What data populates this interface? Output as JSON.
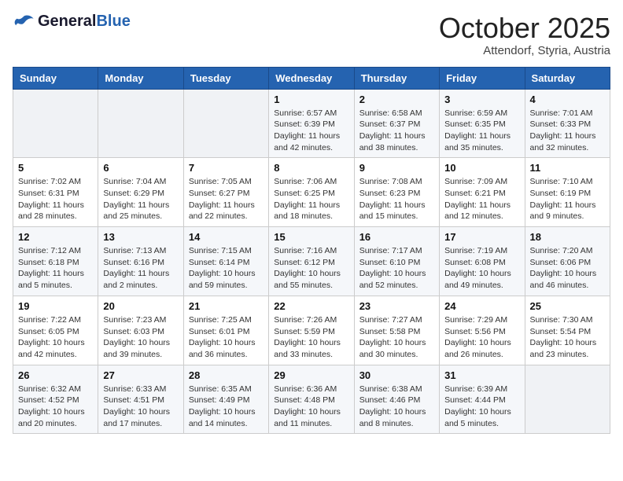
{
  "header": {
    "logo_general": "General",
    "logo_blue": "Blue",
    "month": "October 2025",
    "location": "Attendorf, Styria, Austria"
  },
  "weekdays": [
    "Sunday",
    "Monday",
    "Tuesday",
    "Wednesday",
    "Thursday",
    "Friday",
    "Saturday"
  ],
  "weeks": [
    [
      {
        "day": "",
        "info": ""
      },
      {
        "day": "",
        "info": ""
      },
      {
        "day": "",
        "info": ""
      },
      {
        "day": "1",
        "info": "Sunrise: 6:57 AM\nSunset: 6:39 PM\nDaylight: 11 hours and 42 minutes."
      },
      {
        "day": "2",
        "info": "Sunrise: 6:58 AM\nSunset: 6:37 PM\nDaylight: 11 hours and 38 minutes."
      },
      {
        "day": "3",
        "info": "Sunrise: 6:59 AM\nSunset: 6:35 PM\nDaylight: 11 hours and 35 minutes."
      },
      {
        "day": "4",
        "info": "Sunrise: 7:01 AM\nSunset: 6:33 PM\nDaylight: 11 hours and 32 minutes."
      }
    ],
    [
      {
        "day": "5",
        "info": "Sunrise: 7:02 AM\nSunset: 6:31 PM\nDaylight: 11 hours and 28 minutes."
      },
      {
        "day": "6",
        "info": "Sunrise: 7:04 AM\nSunset: 6:29 PM\nDaylight: 11 hours and 25 minutes."
      },
      {
        "day": "7",
        "info": "Sunrise: 7:05 AM\nSunset: 6:27 PM\nDaylight: 11 hours and 22 minutes."
      },
      {
        "day": "8",
        "info": "Sunrise: 7:06 AM\nSunset: 6:25 PM\nDaylight: 11 hours and 18 minutes."
      },
      {
        "day": "9",
        "info": "Sunrise: 7:08 AM\nSunset: 6:23 PM\nDaylight: 11 hours and 15 minutes."
      },
      {
        "day": "10",
        "info": "Sunrise: 7:09 AM\nSunset: 6:21 PM\nDaylight: 11 hours and 12 minutes."
      },
      {
        "day": "11",
        "info": "Sunrise: 7:10 AM\nSunset: 6:19 PM\nDaylight: 11 hours and 9 minutes."
      }
    ],
    [
      {
        "day": "12",
        "info": "Sunrise: 7:12 AM\nSunset: 6:18 PM\nDaylight: 11 hours and 5 minutes."
      },
      {
        "day": "13",
        "info": "Sunrise: 7:13 AM\nSunset: 6:16 PM\nDaylight: 11 hours and 2 minutes."
      },
      {
        "day": "14",
        "info": "Sunrise: 7:15 AM\nSunset: 6:14 PM\nDaylight: 10 hours and 59 minutes."
      },
      {
        "day": "15",
        "info": "Sunrise: 7:16 AM\nSunset: 6:12 PM\nDaylight: 10 hours and 55 minutes."
      },
      {
        "day": "16",
        "info": "Sunrise: 7:17 AM\nSunset: 6:10 PM\nDaylight: 10 hours and 52 minutes."
      },
      {
        "day": "17",
        "info": "Sunrise: 7:19 AM\nSunset: 6:08 PM\nDaylight: 10 hours and 49 minutes."
      },
      {
        "day": "18",
        "info": "Sunrise: 7:20 AM\nSunset: 6:06 PM\nDaylight: 10 hours and 46 minutes."
      }
    ],
    [
      {
        "day": "19",
        "info": "Sunrise: 7:22 AM\nSunset: 6:05 PM\nDaylight: 10 hours and 42 minutes."
      },
      {
        "day": "20",
        "info": "Sunrise: 7:23 AM\nSunset: 6:03 PM\nDaylight: 10 hours and 39 minutes."
      },
      {
        "day": "21",
        "info": "Sunrise: 7:25 AM\nSunset: 6:01 PM\nDaylight: 10 hours and 36 minutes."
      },
      {
        "day": "22",
        "info": "Sunrise: 7:26 AM\nSunset: 5:59 PM\nDaylight: 10 hours and 33 minutes."
      },
      {
        "day": "23",
        "info": "Sunrise: 7:27 AM\nSunset: 5:58 PM\nDaylight: 10 hours and 30 minutes."
      },
      {
        "day": "24",
        "info": "Sunrise: 7:29 AM\nSunset: 5:56 PM\nDaylight: 10 hours and 26 minutes."
      },
      {
        "day": "25",
        "info": "Sunrise: 7:30 AM\nSunset: 5:54 PM\nDaylight: 10 hours and 23 minutes."
      }
    ],
    [
      {
        "day": "26",
        "info": "Sunrise: 6:32 AM\nSunset: 4:52 PM\nDaylight: 10 hours and 20 minutes."
      },
      {
        "day": "27",
        "info": "Sunrise: 6:33 AM\nSunset: 4:51 PM\nDaylight: 10 hours and 17 minutes."
      },
      {
        "day": "28",
        "info": "Sunrise: 6:35 AM\nSunset: 4:49 PM\nDaylight: 10 hours and 14 minutes."
      },
      {
        "day": "29",
        "info": "Sunrise: 6:36 AM\nSunset: 4:48 PM\nDaylight: 10 hours and 11 minutes."
      },
      {
        "day": "30",
        "info": "Sunrise: 6:38 AM\nSunset: 4:46 PM\nDaylight: 10 hours and 8 minutes."
      },
      {
        "day": "31",
        "info": "Sunrise: 6:39 AM\nSunset: 4:44 PM\nDaylight: 10 hours and 5 minutes."
      },
      {
        "day": "",
        "info": ""
      }
    ]
  ]
}
